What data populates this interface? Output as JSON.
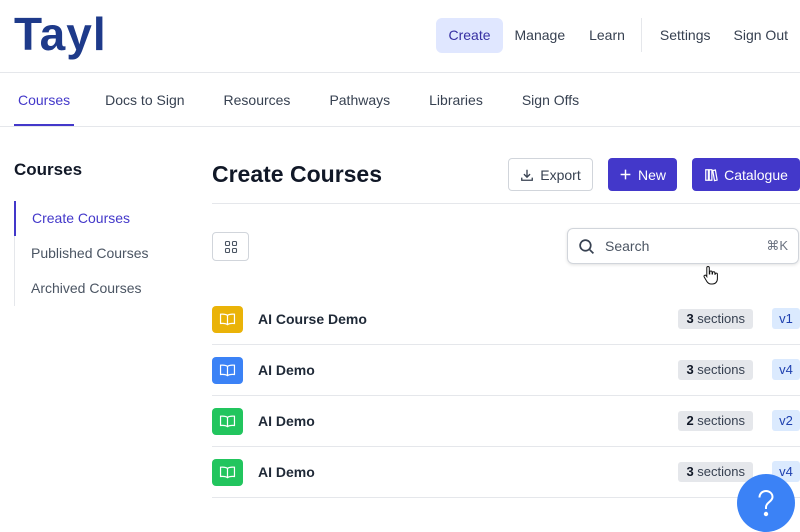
{
  "header": {
    "logo_text": "Tayl",
    "nav": [
      {
        "label": "Create",
        "active": true
      },
      {
        "label": "Manage"
      },
      {
        "label": "Learn"
      },
      {
        "label": "Settings"
      },
      {
        "label": "Sign Out"
      }
    ]
  },
  "subnav": {
    "tabs": [
      {
        "label": "Courses",
        "active": true
      },
      {
        "label": "Docs to Sign"
      },
      {
        "label": "Resources"
      },
      {
        "label": "Pathways"
      },
      {
        "label": "Libraries"
      },
      {
        "label": "Sign Offs"
      }
    ]
  },
  "sidebar": {
    "title": "Courses",
    "items": [
      {
        "label": "Create Courses",
        "active": true
      },
      {
        "label": "Published Courses"
      },
      {
        "label": "Archived Courses"
      }
    ]
  },
  "main": {
    "title": "Create Courses",
    "export_label": "Export",
    "new_label": "New",
    "catalogue_label": "Catalogue",
    "search_placeholder": "Search",
    "search_shortcut": "⌘K",
    "courses": [
      {
        "name": "AI Course Demo",
        "sections_count": "3",
        "sections_word": "sections",
        "version": "v1",
        "icon_color": "#eab308"
      },
      {
        "name": "AI Demo",
        "sections_count": "3",
        "sections_word": "sections",
        "version": "v4",
        "icon_color": "#3b82f6"
      },
      {
        "name": "AI Demo",
        "sections_count": "2",
        "sections_word": "sections",
        "version": "v2",
        "icon_color": "#22c55e"
      },
      {
        "name": "AI Demo",
        "sections_count": "3",
        "sections_word": "sections",
        "version": "v4",
        "icon_color": "#22c55e"
      }
    ]
  },
  "help": {
    "icon": "question-icon"
  },
  "colors": {
    "accent": "#4338ca",
    "logo": "#1e3a8a"
  }
}
